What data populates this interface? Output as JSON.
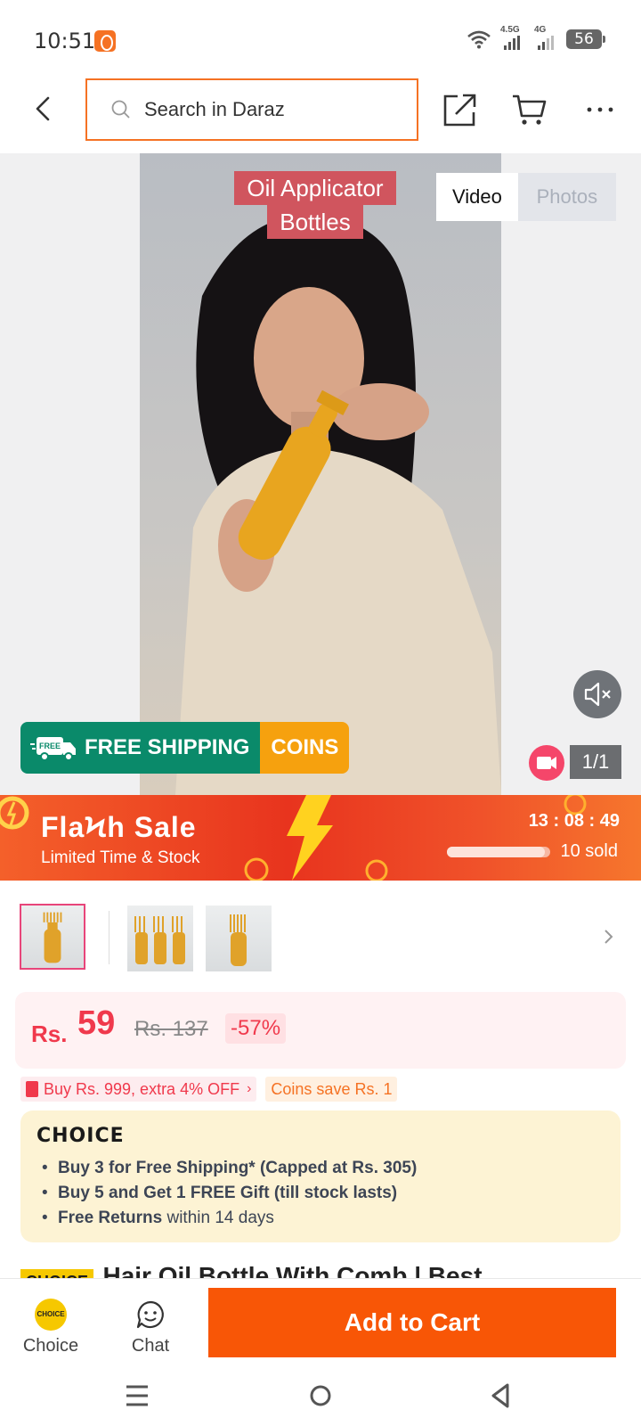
{
  "status_bar": {
    "time": "10:51",
    "network_1": "4.5G",
    "network_2": "4G",
    "battery": "56"
  },
  "header": {
    "search_placeholder": "Search in Daraz",
    "icons": [
      "back-arrow-icon",
      "search-icon",
      "share-icon",
      "cart-icon",
      "more-icon"
    ]
  },
  "gallery": {
    "video_caption_line1": "Oil Applicator",
    "video_caption_line2": "Bottles",
    "tab_video": "Video",
    "tab_photos": "Photos",
    "counter": "1/1",
    "free_badge": "FREE",
    "free_shipping": "FREE SHIPPING",
    "coins": "COINS"
  },
  "flash_sale": {
    "title": "FlaϞh Sale",
    "subtitle": "Limited Time & Stock",
    "hours": "13",
    "minutes": "08",
    "seconds": "49",
    "sold": "10 sold",
    "sold_fraction": 0.95
  },
  "price": {
    "currency": "Rs.",
    "value": "59",
    "original": "Rs. 137",
    "discount": "-57%"
  },
  "promos": {
    "voucher": "Buy Rs. 999, extra 4% OFF",
    "coins": "Coins save Rs. 1"
  },
  "choice": {
    "logo": "CHOICE",
    "item1": "Buy 3 for  Free Shipping* (Capped at Rs. 305)",
    "item2": "Buy 5 and Get 1 FREE Gift (till stock lasts)",
    "item3_bold": "Free Returns",
    "item3_rest": " within 14 days"
  },
  "product": {
    "badge": "CHOICE",
    "title": "Hair Oil Bottle With Comb | Best"
  },
  "bottom_bar": {
    "choice_label": "Choice",
    "choice_coin_text": "CHOICE",
    "chat_label": "Chat",
    "add_to_cart": "Add to Cart"
  },
  "colors": {
    "brand_orange": "#f85606",
    "price_red": "#f0394c",
    "free_shipping_green": "#0a8a6a",
    "coins_amber": "#f6a10e"
  }
}
